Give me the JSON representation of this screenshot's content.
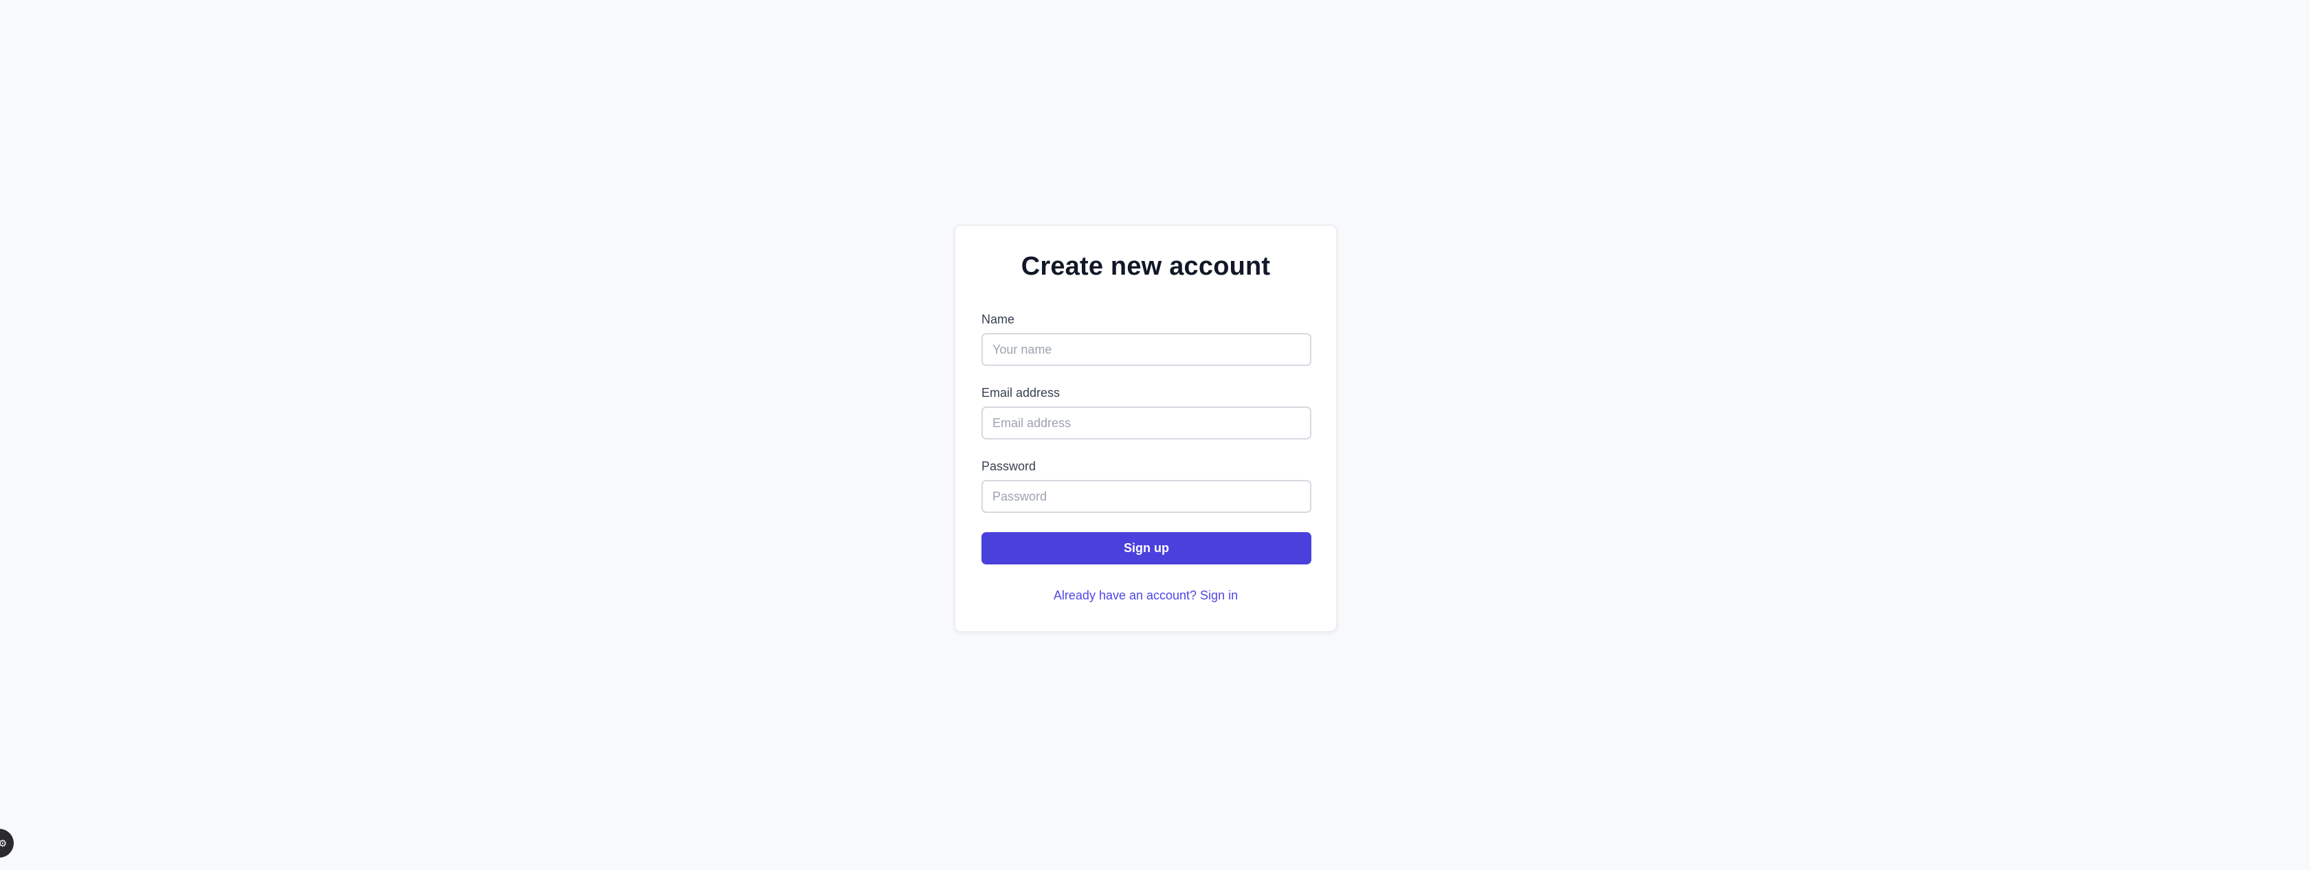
{
  "form": {
    "title": "Create new account",
    "fields": [
      {
        "label": "Name",
        "placeholder": "Your name",
        "value": ""
      },
      {
        "label": "Email address",
        "placeholder": "Email address",
        "value": ""
      },
      {
        "label": "Password",
        "placeholder": "Password",
        "value": ""
      }
    ],
    "submit_label": "Sign up",
    "signin_link": "Already have an account? Sign in"
  },
  "colors": {
    "accent": "#4a40dc",
    "link": "#4f46e5",
    "background": "#f8f9fb"
  },
  "icons": {
    "corner_badge": "settings-gear-icon"
  }
}
